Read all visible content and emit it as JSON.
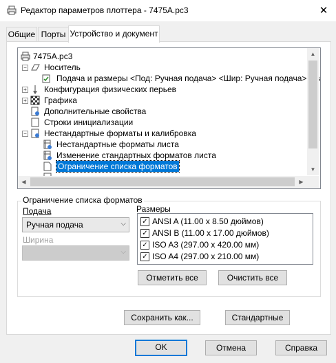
{
  "window": {
    "title": "Редактор параметров плоттера - 7475A.pc3",
    "close_label": "✕"
  },
  "tabs": [
    "Общие",
    "Порты",
    "Устройство и документ"
  ],
  "tree": {
    "items": [
      {
        "label": "7475A.pc3"
      },
      {
        "label": "Носитель",
        "expander": "−"
      },
      {
        "label": "Подача и размеры <Под:  Ручная подача> <Шир: Ручная подача> <Ра:"
      },
      {
        "label": "Конфигурация физических перьев",
        "expander": "+"
      },
      {
        "label": "Графика",
        "expander": "+"
      },
      {
        "label": "Дополнительные свойства"
      },
      {
        "label": "Строки инициализации"
      },
      {
        "label": "Нестандартные форматы и калибровка",
        "expander": "−"
      },
      {
        "label": "Нестандартные форматы листа"
      },
      {
        "label": "Изменение стандартных форматов листа"
      },
      {
        "label": "Ограничение списка форматов",
        "selected": true
      }
    ],
    "scroll": {
      "up": "▲",
      "down": "▼",
      "left": "◀",
      "right": "▶"
    }
  },
  "restrict_group": {
    "title": "Ограничение списка форматов",
    "feed_label": "Подача",
    "feed_value": "Ручная подача",
    "width_label": "Ширина",
    "width_value": "",
    "sizes_label": "Размеры",
    "sizes": [
      {
        "label": "ANSI A (11.00 x 8.50 дюймов)",
        "checked": true
      },
      {
        "label": "ANSI B (11.00 x 17.00 дюймов)",
        "checked": true
      },
      {
        "label": "ISO A3 (297.00 x 420.00 мм)",
        "checked": true
      },
      {
        "label": "ISO A4 (297.00 x 210.00 мм)",
        "checked": true
      }
    ],
    "check_mark": "✓",
    "check_all": "Отметить все",
    "clear_all": "Очистить все"
  },
  "buttons": {
    "save_as": "Сохранить как...",
    "defaults": "Стандартные",
    "ok": "OK",
    "cancel": "Отмена",
    "help": "Справка"
  },
  "dropdown_arrow": "⌵"
}
